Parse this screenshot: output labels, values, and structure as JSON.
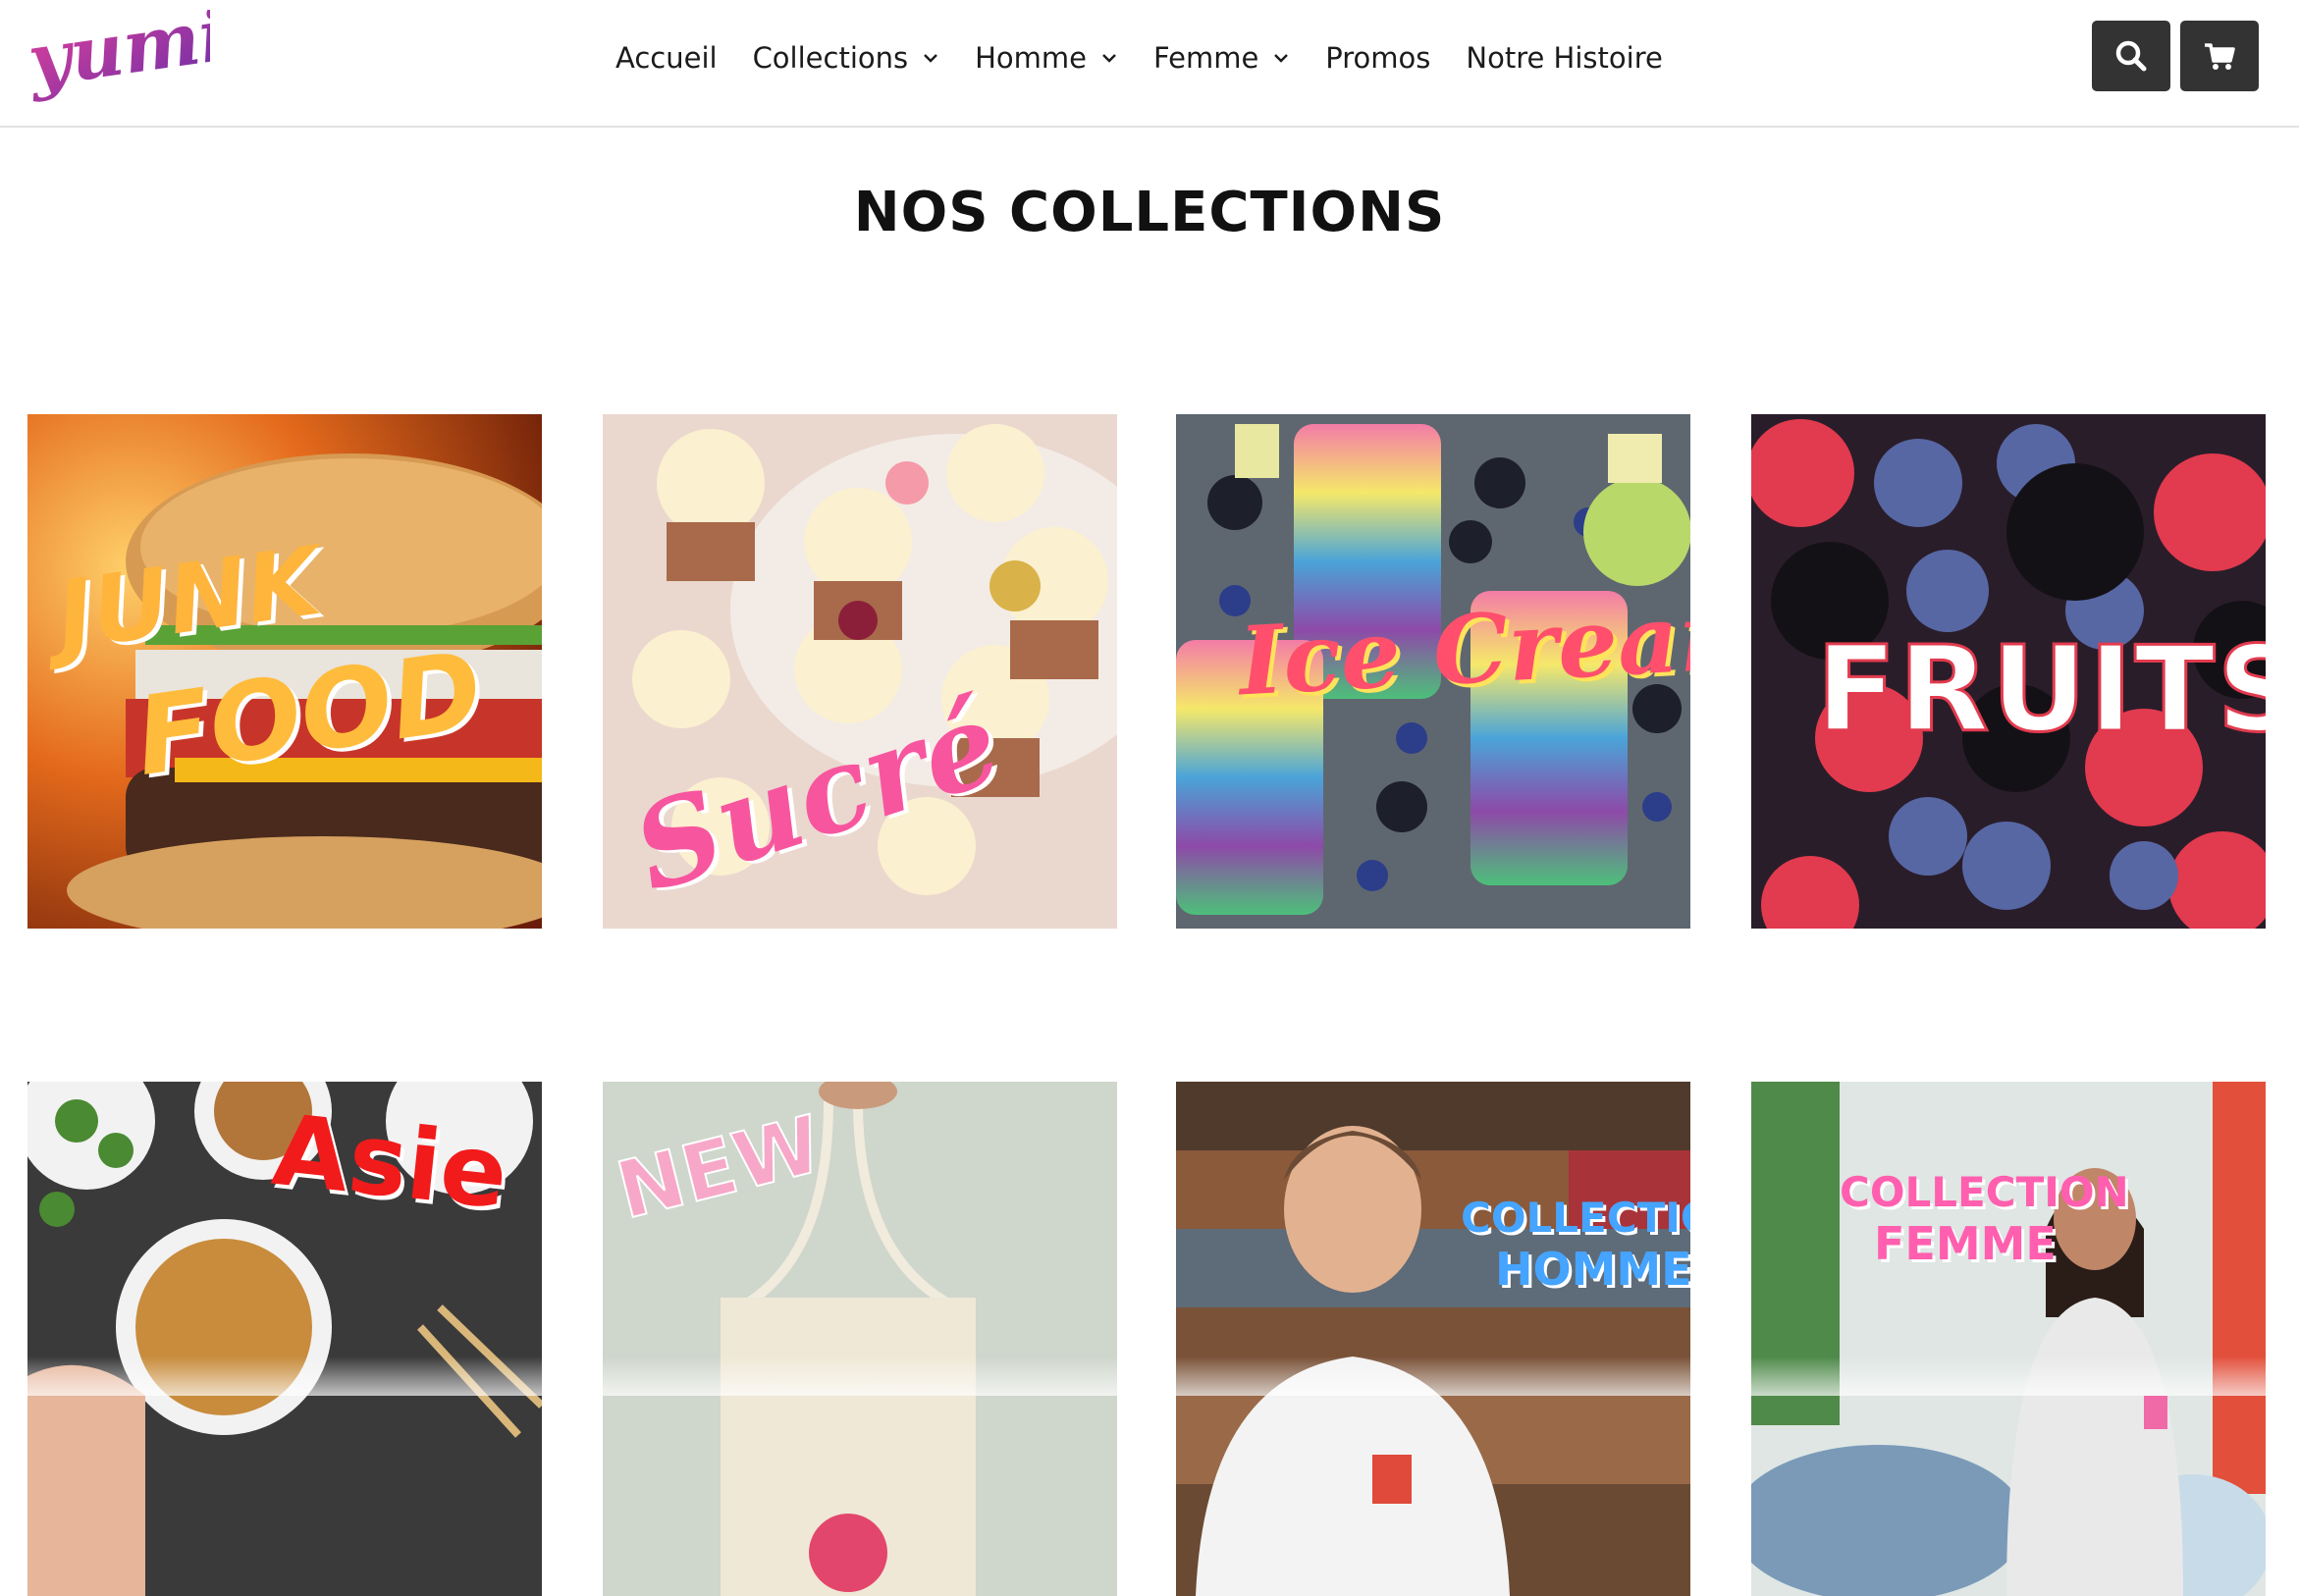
{
  "header": {
    "logo_text": "yumi",
    "nav": [
      {
        "label": "Accueil",
        "has_dropdown": false
      },
      {
        "label": "Collections",
        "has_dropdown": true
      },
      {
        "label": "Homme",
        "has_dropdown": true
      },
      {
        "label": "Femme",
        "has_dropdown": true
      },
      {
        "label": "Promos",
        "has_dropdown": false
      },
      {
        "label": "Notre Histoire",
        "has_dropdown": false
      }
    ],
    "icons": {
      "search": "search-icon",
      "cart": "cart-icon"
    },
    "button_color": "#333333"
  },
  "main": {
    "title": "NOS COLLECTIONS",
    "collections": [
      {
        "label": "JUNK FOOD",
        "line1": "JUNK",
        "line2": "FOOD",
        "color": "#ffb43c"
      },
      {
        "label": "Sucré",
        "color": "#f7569f"
      },
      {
        "label": "Ice Cream",
        "color": "#ff4f6d"
      },
      {
        "label": "FRUITS",
        "color": "#ffffff"
      },
      {
        "label": "Asie",
        "color": "#f21b1b"
      },
      {
        "label": "NEW",
        "color": "#f7a8c8"
      },
      {
        "label": "COLLECTION HOMME",
        "line1": "COLLECTION",
        "line2": "HOMME",
        "color": "#45a4ff"
      },
      {
        "label": "COLLECTION FEMME",
        "line1": "COLLECTION",
        "line2": "FEMME",
        "color": "#ff5fae"
      }
    ]
  },
  "colors": {
    "logo_gradient": [
      "#e0409a",
      "#6b2fa8"
    ],
    "divider": "#e2e2e2"
  }
}
